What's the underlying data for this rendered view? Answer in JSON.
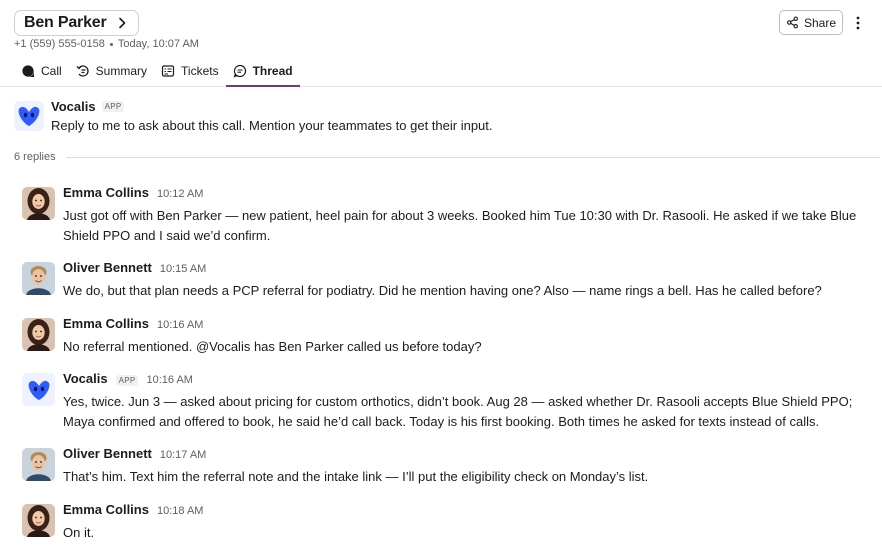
{
  "header": {
    "contact_name": "Ben Parker",
    "phone": "+1 (559) 555-0158",
    "timestamp": "Today, 10:07 AM",
    "share_label": "Share"
  },
  "tabs": [
    {
      "label": "Call",
      "icon": "phone-icon",
      "active": false
    },
    {
      "label": "Summary",
      "icon": "summary-icon",
      "active": false
    },
    {
      "label": "Tickets",
      "icon": "tickets-icon",
      "active": false
    },
    {
      "label": "Thread",
      "icon": "thread-icon",
      "active": true
    }
  ],
  "intro": {
    "author": "Vocalis",
    "badge": "APP",
    "text": "Reply to me to ask about this call. Mention your teammates to get their input."
  },
  "replies_count_label": "6 replies",
  "messages": [
    {
      "author": "Emma Collins",
      "time": "10:12 AM",
      "text": "Just got off with Ben Parker — new patient, heel pain for about 3 weeks. Booked him Tue 10:30 with Dr. Rasooli. He asked if we take Blue Shield PPO and I said we’d confirm."
    },
    {
      "author": "Oliver Bennett",
      "time": "10:15 AM",
      "text": "We do, but that plan needs a PCP referral for podiatry. Did he mention having one? Also — name rings a bell. Has he called before?"
    },
    {
      "author": "Emma Collins",
      "time": "10:16 AM",
      "text": "No referral mentioned. @Vocalis has Ben Parker called us before today?"
    },
    {
      "author": "Vocalis",
      "badge": "APP",
      "time": "10:16 AM",
      "text": "Yes, twice. Jun 3 — asked about pricing for custom orthotics, didn’t book. Aug 28 — asked whether Dr. Rasooli accepts Blue Shield PPO; Maya confirmed and offered to book, he said he’d call back. Today is his first booking. Both times he asked for texts instead of calls."
    },
    {
      "author": "Oliver Bennett",
      "time": "10:17 AM",
      "text": "That’s him. Text him the referral note and the intake link — I’ll put the eligibility check on Monday’s list."
    },
    {
      "author": "Emma Collins",
      "time": "10:18 AM",
      "text": "On it."
    }
  ],
  "colors": {
    "accent_tab_underline": "#6b3a8c",
    "vocalis_brand": "#2f5bff"
  }
}
